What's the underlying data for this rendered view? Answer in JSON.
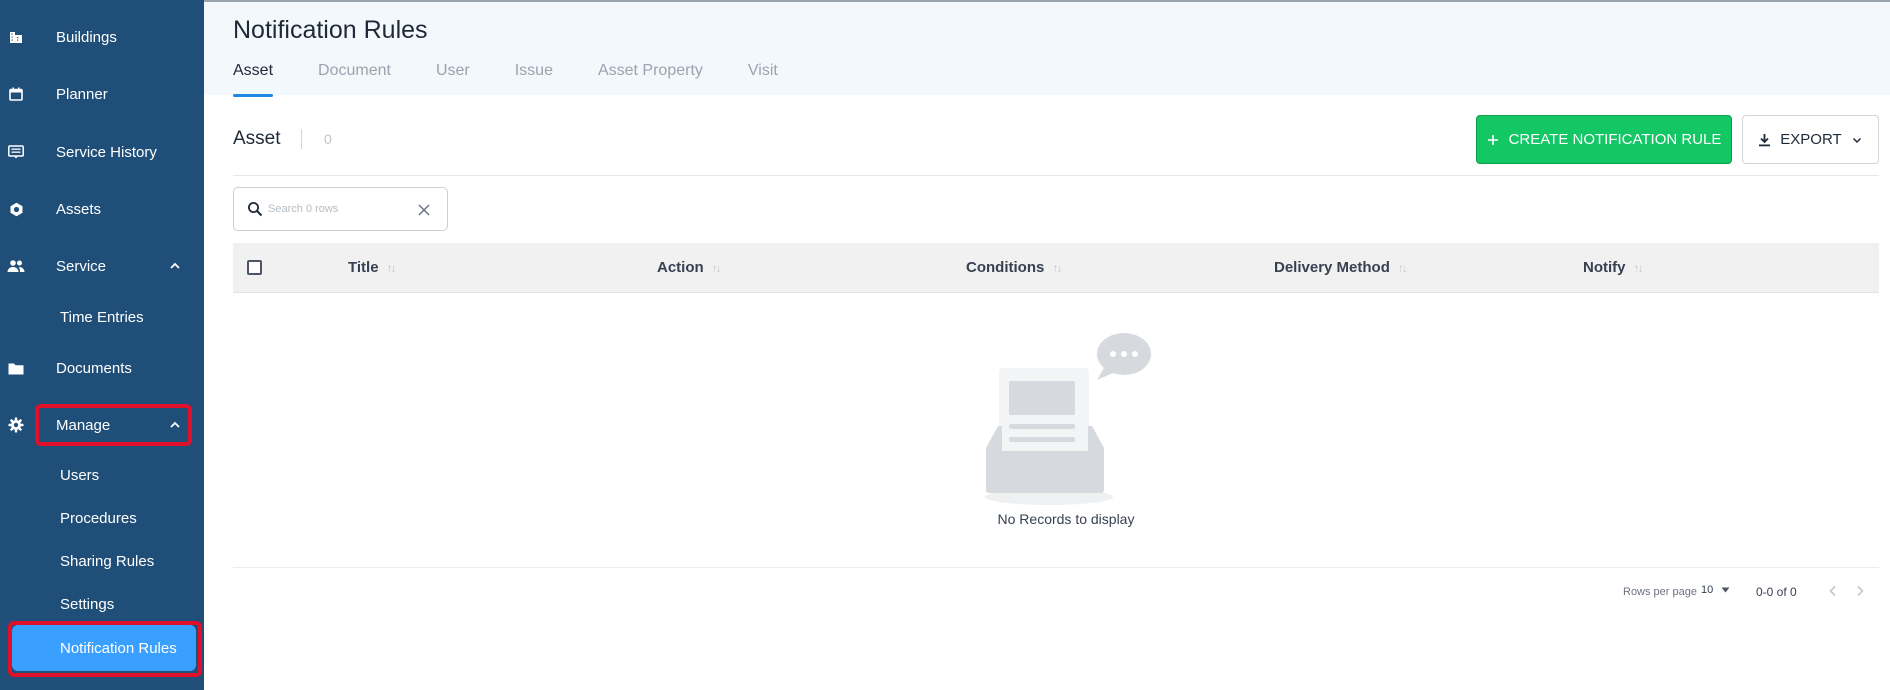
{
  "sidebar": {
    "items": [
      {
        "label": "Buildings",
        "icon": "building-icon"
      },
      {
        "label": "Planner",
        "icon": "calendar-icon"
      },
      {
        "label": "Service History",
        "icon": "list-icon"
      },
      {
        "label": "Assets",
        "icon": "hexagon-icon"
      },
      {
        "label": "Service",
        "icon": "people-icon",
        "expanded": true,
        "children": [
          {
            "label": "Time Entries"
          }
        ]
      },
      {
        "label": "Documents",
        "icon": "folder-icon"
      },
      {
        "label": "Manage",
        "icon": "gear-icon",
        "expanded": true,
        "children": [
          {
            "label": "Users"
          },
          {
            "label": "Procedures"
          },
          {
            "label": "Sharing Rules"
          },
          {
            "label": "Settings"
          },
          {
            "label": "Notification Rules",
            "active": true
          }
        ]
      }
    ],
    "highlight_color": "#e0102a",
    "background": "#1f4e79",
    "active_color": "#3aa0ff"
  },
  "header": {
    "title": "Notification Rules",
    "tabs": [
      "Asset",
      "Document",
      "User",
      "Issue",
      "Asset Property",
      "Visit"
    ],
    "active_tab": "Asset"
  },
  "main": {
    "section_title": "Asset",
    "count": "0",
    "create_button": "CREATE NOTIFICATION RULE",
    "export_button": "EXPORT",
    "search_placeholder": "Search 0 rows",
    "columns": [
      "Title",
      "Action",
      "Conditions",
      "Delivery Method",
      "Notify"
    ],
    "empty_text": "No Records to display",
    "rows_per_page_label": "Rows per page",
    "rows_per_page": "10",
    "range": "0-0 of 0",
    "accent": "#13c765"
  }
}
